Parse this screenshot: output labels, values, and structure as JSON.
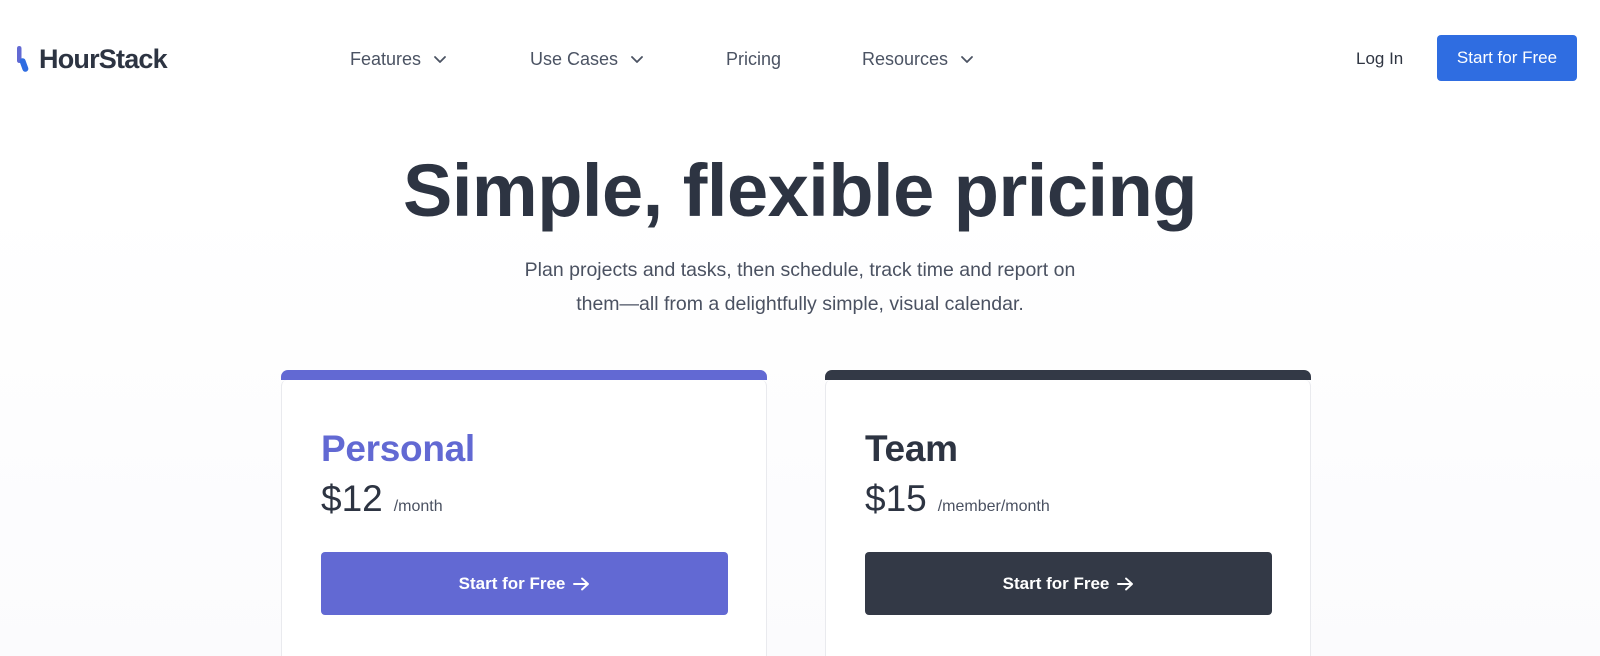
{
  "colors": {
    "primary_blue": "#2f6de1",
    "personal_accent": "#6269d3",
    "team_accent": "#333946",
    "text_dark": "#2d3442"
  },
  "brand": {
    "name": "HourStack",
    "logo_icon": "hourstack-logo-icon"
  },
  "nav": {
    "items": [
      {
        "label": "Features",
        "has_dropdown": true
      },
      {
        "label": "Use Cases",
        "has_dropdown": true
      },
      {
        "label": "Pricing",
        "has_dropdown": false
      },
      {
        "label": "Resources",
        "has_dropdown": true
      }
    ],
    "login_label": "Log In",
    "cta_label": "Start for Free"
  },
  "hero": {
    "title": "Simple, flexible pricing",
    "subtitle_line1": "Plan projects and tasks, then schedule, track time and report on",
    "subtitle_line2": "them—all from a delightfully simple, visual calendar."
  },
  "plans": [
    {
      "name": "Personal",
      "price": "$12",
      "unit": "/month",
      "button_label": "Start for Free",
      "button_icon": "arrow-right-icon",
      "accent": "#6269d3"
    },
    {
      "name": "Team",
      "price": "$15",
      "unit": "/member/month",
      "button_label": "Start for Free",
      "button_icon": "arrow-right-icon",
      "accent": "#333946"
    }
  ]
}
